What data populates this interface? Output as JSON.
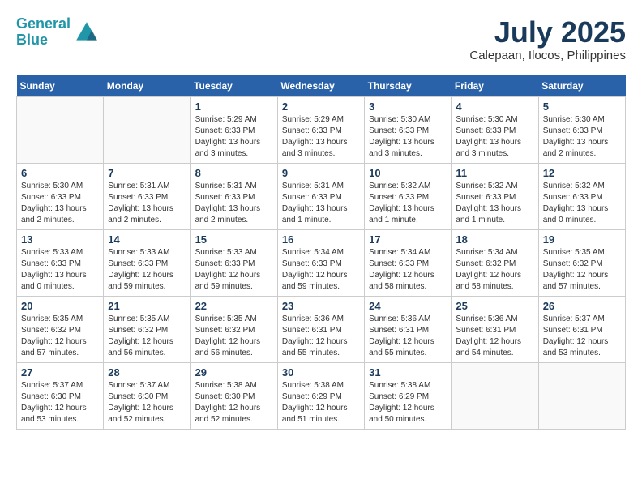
{
  "header": {
    "logo_line1": "General",
    "logo_line2": "Blue",
    "month_year": "July 2025",
    "location": "Calepaan, Ilocos, Philippines"
  },
  "weekdays": [
    "Sunday",
    "Monday",
    "Tuesday",
    "Wednesday",
    "Thursday",
    "Friday",
    "Saturday"
  ],
  "weeks": [
    [
      {
        "day": "",
        "info": ""
      },
      {
        "day": "",
        "info": ""
      },
      {
        "day": "1",
        "info": "Sunrise: 5:29 AM\nSunset: 6:33 PM\nDaylight: 13 hours and 3 minutes."
      },
      {
        "day": "2",
        "info": "Sunrise: 5:29 AM\nSunset: 6:33 PM\nDaylight: 13 hours and 3 minutes."
      },
      {
        "day": "3",
        "info": "Sunrise: 5:30 AM\nSunset: 6:33 PM\nDaylight: 13 hours and 3 minutes."
      },
      {
        "day": "4",
        "info": "Sunrise: 5:30 AM\nSunset: 6:33 PM\nDaylight: 13 hours and 3 minutes."
      },
      {
        "day": "5",
        "info": "Sunrise: 5:30 AM\nSunset: 6:33 PM\nDaylight: 13 hours and 2 minutes."
      }
    ],
    [
      {
        "day": "6",
        "info": "Sunrise: 5:30 AM\nSunset: 6:33 PM\nDaylight: 13 hours and 2 minutes."
      },
      {
        "day": "7",
        "info": "Sunrise: 5:31 AM\nSunset: 6:33 PM\nDaylight: 13 hours and 2 minutes."
      },
      {
        "day": "8",
        "info": "Sunrise: 5:31 AM\nSunset: 6:33 PM\nDaylight: 13 hours and 2 minutes."
      },
      {
        "day": "9",
        "info": "Sunrise: 5:31 AM\nSunset: 6:33 PM\nDaylight: 13 hours and 1 minute."
      },
      {
        "day": "10",
        "info": "Sunrise: 5:32 AM\nSunset: 6:33 PM\nDaylight: 13 hours and 1 minute."
      },
      {
        "day": "11",
        "info": "Sunrise: 5:32 AM\nSunset: 6:33 PM\nDaylight: 13 hours and 1 minute."
      },
      {
        "day": "12",
        "info": "Sunrise: 5:32 AM\nSunset: 6:33 PM\nDaylight: 13 hours and 0 minutes."
      }
    ],
    [
      {
        "day": "13",
        "info": "Sunrise: 5:33 AM\nSunset: 6:33 PM\nDaylight: 13 hours and 0 minutes."
      },
      {
        "day": "14",
        "info": "Sunrise: 5:33 AM\nSunset: 6:33 PM\nDaylight: 12 hours and 59 minutes."
      },
      {
        "day": "15",
        "info": "Sunrise: 5:33 AM\nSunset: 6:33 PM\nDaylight: 12 hours and 59 minutes."
      },
      {
        "day": "16",
        "info": "Sunrise: 5:34 AM\nSunset: 6:33 PM\nDaylight: 12 hours and 59 minutes."
      },
      {
        "day": "17",
        "info": "Sunrise: 5:34 AM\nSunset: 6:33 PM\nDaylight: 12 hours and 58 minutes."
      },
      {
        "day": "18",
        "info": "Sunrise: 5:34 AM\nSunset: 6:32 PM\nDaylight: 12 hours and 58 minutes."
      },
      {
        "day": "19",
        "info": "Sunrise: 5:35 AM\nSunset: 6:32 PM\nDaylight: 12 hours and 57 minutes."
      }
    ],
    [
      {
        "day": "20",
        "info": "Sunrise: 5:35 AM\nSunset: 6:32 PM\nDaylight: 12 hours and 57 minutes."
      },
      {
        "day": "21",
        "info": "Sunrise: 5:35 AM\nSunset: 6:32 PM\nDaylight: 12 hours and 56 minutes."
      },
      {
        "day": "22",
        "info": "Sunrise: 5:35 AM\nSunset: 6:32 PM\nDaylight: 12 hours and 56 minutes."
      },
      {
        "day": "23",
        "info": "Sunrise: 5:36 AM\nSunset: 6:31 PM\nDaylight: 12 hours and 55 minutes."
      },
      {
        "day": "24",
        "info": "Sunrise: 5:36 AM\nSunset: 6:31 PM\nDaylight: 12 hours and 55 minutes."
      },
      {
        "day": "25",
        "info": "Sunrise: 5:36 AM\nSunset: 6:31 PM\nDaylight: 12 hours and 54 minutes."
      },
      {
        "day": "26",
        "info": "Sunrise: 5:37 AM\nSunset: 6:31 PM\nDaylight: 12 hours and 53 minutes."
      }
    ],
    [
      {
        "day": "27",
        "info": "Sunrise: 5:37 AM\nSunset: 6:30 PM\nDaylight: 12 hours and 53 minutes."
      },
      {
        "day": "28",
        "info": "Sunrise: 5:37 AM\nSunset: 6:30 PM\nDaylight: 12 hours and 52 minutes."
      },
      {
        "day": "29",
        "info": "Sunrise: 5:38 AM\nSunset: 6:30 PM\nDaylight: 12 hours and 52 minutes."
      },
      {
        "day": "30",
        "info": "Sunrise: 5:38 AM\nSunset: 6:29 PM\nDaylight: 12 hours and 51 minutes."
      },
      {
        "day": "31",
        "info": "Sunrise: 5:38 AM\nSunset: 6:29 PM\nDaylight: 12 hours and 50 minutes."
      },
      {
        "day": "",
        "info": ""
      },
      {
        "day": "",
        "info": ""
      }
    ]
  ]
}
